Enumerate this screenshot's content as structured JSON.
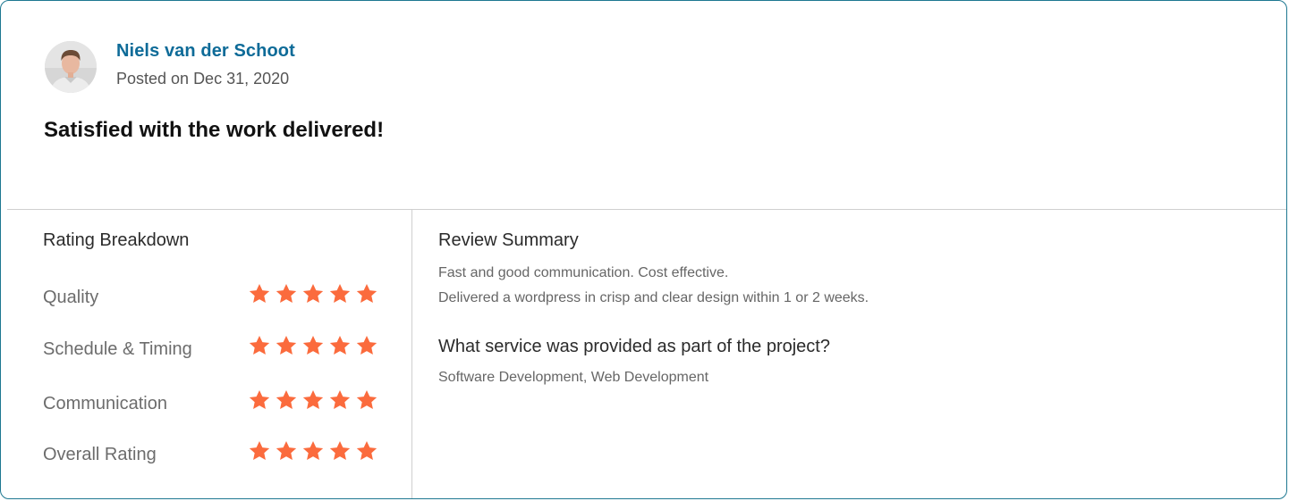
{
  "reviewer": {
    "name": "Niels van der Schoot",
    "posted": "Posted on Dec 31, 2020",
    "avatar_icon": "person-avatar"
  },
  "review_title": "Satisfied with the work delivered!",
  "breakdown": {
    "heading": "Rating Breakdown",
    "star_color": "#fb6b3d",
    "rows": [
      {
        "label": "Quality",
        "stars": 5,
        "max": 5
      },
      {
        "label": "Schedule & Timing",
        "stars": 5,
        "max": 5
      },
      {
        "label": "Communication",
        "stars": 5,
        "max": 5
      },
      {
        "label": "Overall Rating",
        "stars": 5,
        "max": 5
      }
    ]
  },
  "summary": {
    "heading": "Review Summary",
    "lines": [
      "Fast and good communication. Cost effective.",
      "Delivered a wordpress in crisp and clear design within 1 or 2 weeks."
    ],
    "question": "What service was provided as part of the project?",
    "answer": "Software Development, Web Development"
  },
  "colors": {
    "border": "#1e7891",
    "name": "#0e6b98",
    "star": "#fb6b3d"
  }
}
